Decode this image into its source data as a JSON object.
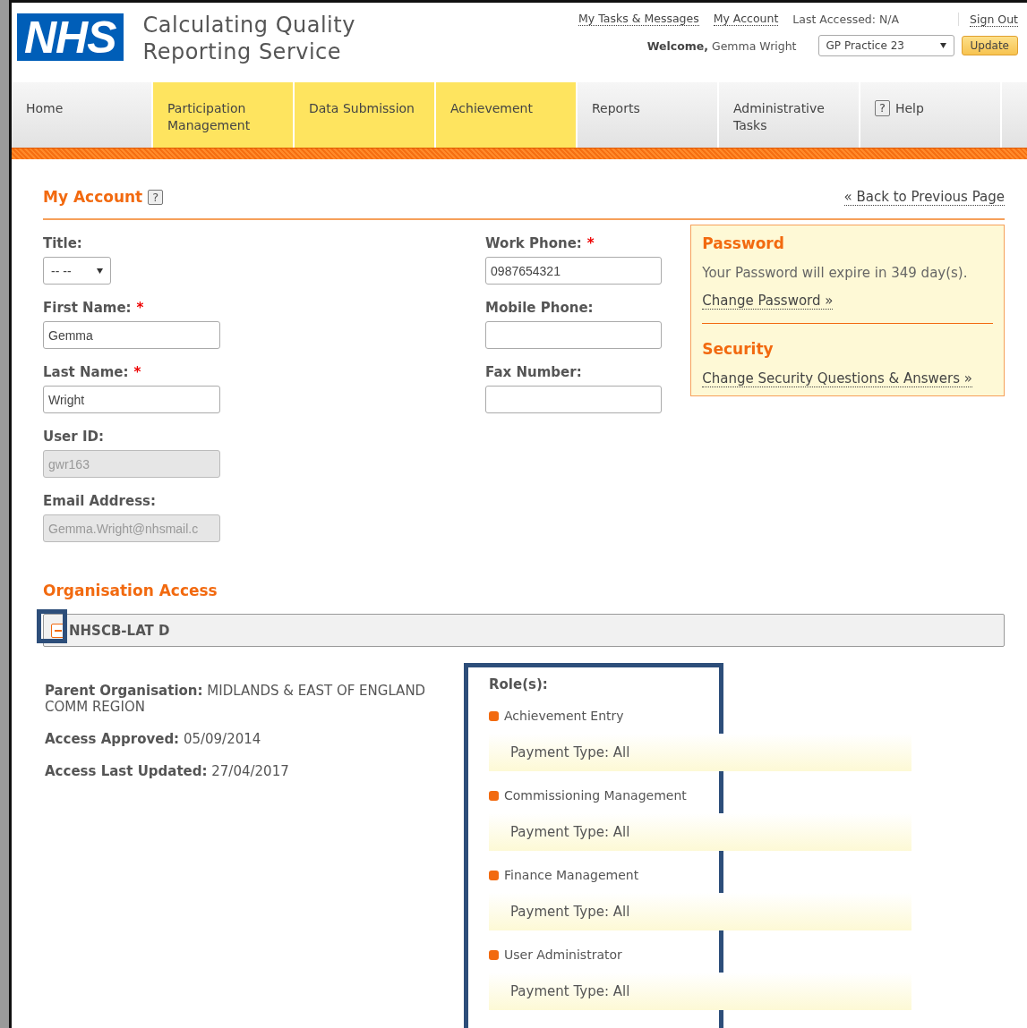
{
  "header": {
    "logo": "NHS",
    "title_lines": [
      "Calculating Quality",
      "Reporting Service"
    ],
    "top_links": [
      {
        "kind": "link",
        "label": "My Tasks & Messages"
      },
      {
        "kind": "link",
        "label": "My Account"
      },
      {
        "kind": "text",
        "label": "Last Accessed: N/A"
      },
      {
        "kind": "link",
        "label": "Sign Out"
      }
    ],
    "welcome_label": "Welcome,",
    "user_name": "Gemma Wright",
    "practice_select": "GP Practice 23",
    "update_button": "Update"
  },
  "nav": [
    {
      "label": "Home",
      "highlighted": false
    },
    {
      "label": "Participation Management",
      "highlighted": true
    },
    {
      "label": "Data Submission",
      "highlighted": true
    },
    {
      "label": "Achievement",
      "highlighted": true
    },
    {
      "label": "Reports",
      "highlighted": false
    },
    {
      "label": "Administrative Tasks",
      "highlighted": false
    },
    {
      "label": "Help",
      "highlighted": false,
      "help_icon": "?"
    }
  ],
  "page": {
    "title": "My Account",
    "help_icon": "?",
    "back_link": "« Back to Previous Page"
  },
  "left_fields": [
    {
      "kind": "select",
      "label": "Title:",
      "required": false,
      "value": "-- --",
      "disabled": false
    },
    {
      "kind": "input",
      "label": "First Name:",
      "required": true,
      "value": "Gemma",
      "disabled": false
    },
    {
      "kind": "input",
      "label": "Last Name:",
      "required": true,
      "value": "Wright",
      "disabled": false
    },
    {
      "kind": "input",
      "label": "User ID:",
      "required": false,
      "value": "gwr163",
      "disabled": true
    },
    {
      "kind": "input",
      "label": "Email Address:",
      "required": false,
      "value": "Gemma.Wright@nhsmail.c",
      "disabled": true
    }
  ],
  "right_fields": [
    {
      "kind": "input",
      "label": "Work Phone:",
      "required": true,
      "value": "0987654321",
      "disabled": false
    },
    {
      "kind": "input",
      "label": "Mobile Phone:",
      "required": false,
      "disabled": false
    },
    {
      "kind": "input",
      "label": "Fax Number:",
      "required": false,
      "disabled": false
    }
  ],
  "required_mark": "*",
  "password_panel": {
    "heading": "Password",
    "message": "Your Password will expire in 349 day(s).",
    "link": "Change Password »",
    "security_heading": "Security",
    "security_link": "Change Security Questions & Answers »"
  },
  "organisation_access": {
    "heading": "Organisation Access",
    "org_name": "NHSCB-LAT D",
    "expanded": true,
    "details": [
      {
        "label": "Parent Organisation:",
        "value": "MIDLANDS & EAST OF ENGLAND COMM REGION"
      },
      {
        "label": "Access Approved:",
        "value": "05/09/2014"
      },
      {
        "label": "Access Last Updated:",
        "value": "27/04/2017"
      }
    ],
    "roles_heading": "Role(s):",
    "roles": [
      {
        "name": "Achievement Entry",
        "payment_type": "Payment Type: All"
      },
      {
        "name": "Commissioning Management",
        "payment_type": "Payment Type: All"
      },
      {
        "name": "Finance Management",
        "payment_type": "Payment Type: All"
      },
      {
        "name": "User Administrator",
        "payment_type": "Payment Type: All"
      }
    ]
  }
}
